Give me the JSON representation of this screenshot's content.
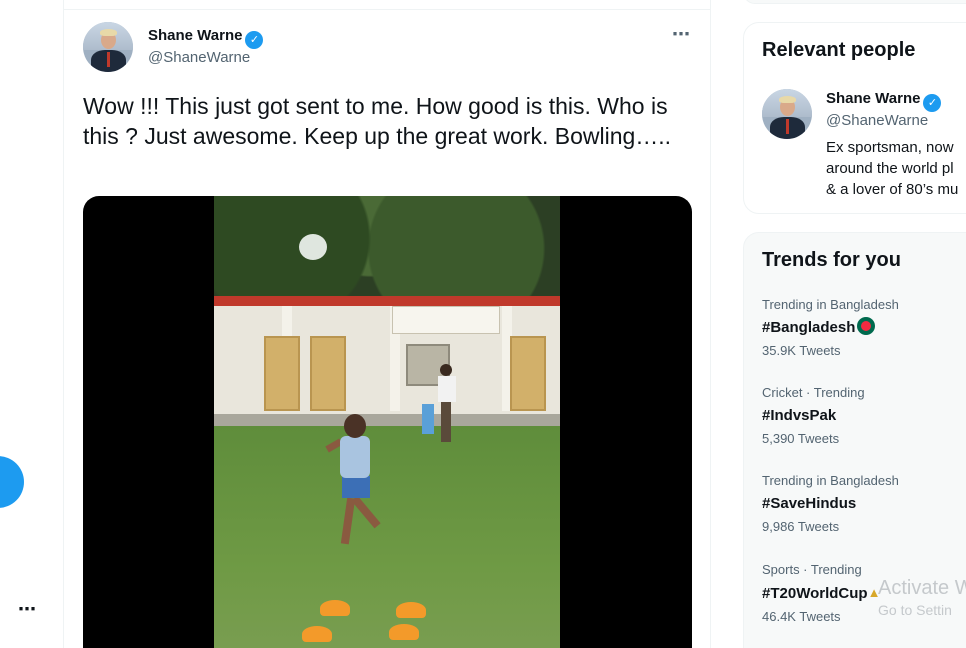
{
  "nav": {
    "more_icon_text": "⋯"
  },
  "tweet": {
    "author_name": "Shane Warne",
    "author_handle": "@ShaneWarne",
    "verified_icon": "✓",
    "more_icon_text": "⋯",
    "text": "Wow !!! This just got sent to me. How good is this. Who is this ? Just awesome. Keep up the great work. Bowling…..",
    "media_sign_text": "উত্তর প্রাথমিক বিদ্যালয়"
  },
  "relevant_people": {
    "title": "Relevant people",
    "name": "Shane Warne",
    "handle": "@ShaneWarne",
    "bio_lines": [
      "Ex sportsman, now",
      "around the world pl",
      "& a lover of 80’s mu"
    ]
  },
  "trends": {
    "title": "Trends for you",
    "items": [
      {
        "meta": "Trending in Bangladesh",
        "tag": "#Bangladesh",
        "count": "35.9K Tweets"
      },
      {
        "meta": "Cricket · Trending",
        "tag": "#IndvsPak",
        "count": "5,390 Tweets"
      },
      {
        "meta": "Trending in Bangladesh",
        "tag": "#SaveHindus",
        "count": "9,986 Tweets"
      },
      {
        "meta": "Sports · Trending",
        "tag": "#T20WorldCup",
        "count": "46.4K Tweets"
      }
    ]
  },
  "watermark": {
    "line1": "Activate W",
    "line2": "Go to Settin"
  },
  "colors": {
    "accent": "#1d9bf0",
    "text": "#0f1419",
    "secondary": "#536471"
  }
}
